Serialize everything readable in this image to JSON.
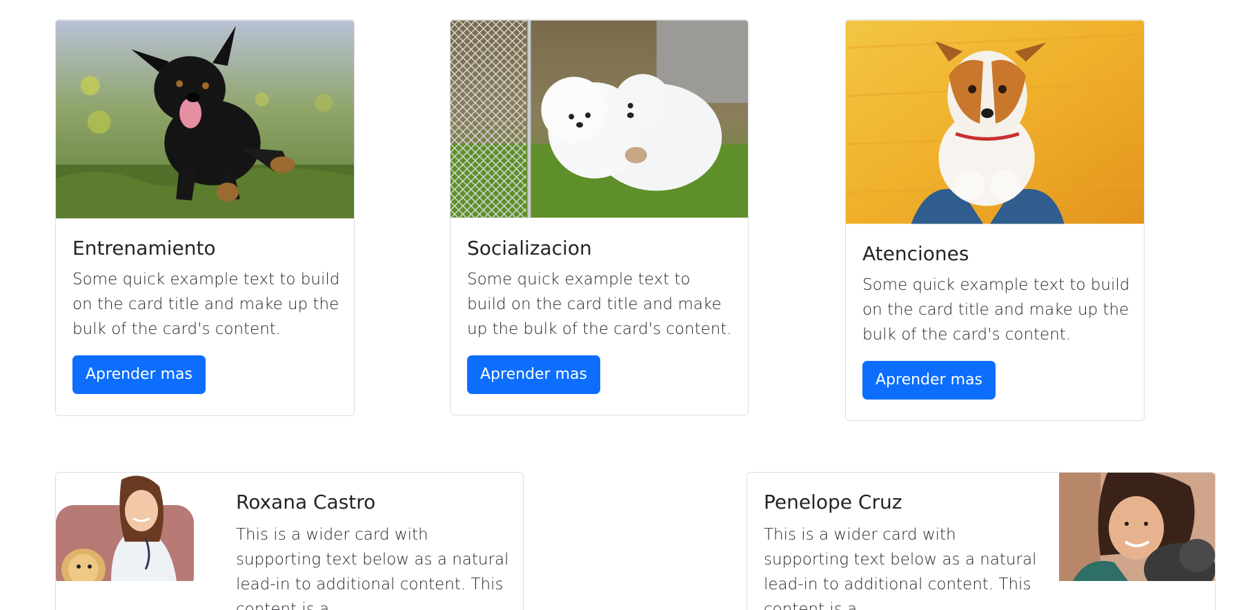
{
  "cards": [
    {
      "title": "Entrenamiento",
      "text": "Some quick example text to build on the card title and make up the bulk of the card's content.",
      "button": "Aprender mas",
      "image_alt": "black puppy running on grass"
    },
    {
      "title": "Socializacion",
      "text": "Some quick example text to build on the card title and make up the bulk of the card's content.",
      "button": "Aprender mas",
      "image_alt": "two white fluffy puppies playing"
    },
    {
      "title": "Atenciones",
      "text": "Some quick example text to build on the card title and make up the bulk of the card's content.",
      "button": "Aprender mas",
      "image_alt": "jack russell terrier on yellow background"
    }
  ],
  "wide_cards": [
    {
      "name": "Roxana Castro",
      "text": "This is a wider card with supporting text below as a natural lead-in to additional content. This content is a",
      "image_alt": "veterinarian with dog"
    },
    {
      "name": "Penelope Cruz",
      "text": "This is a wider card with supporting text below as a natural lead-in to additional content. This content is a",
      "image_alt": "woman holding cat"
    }
  ],
  "colors": {
    "primary": "#0d6efd",
    "border": "#dcdee1",
    "text": "#212529"
  }
}
